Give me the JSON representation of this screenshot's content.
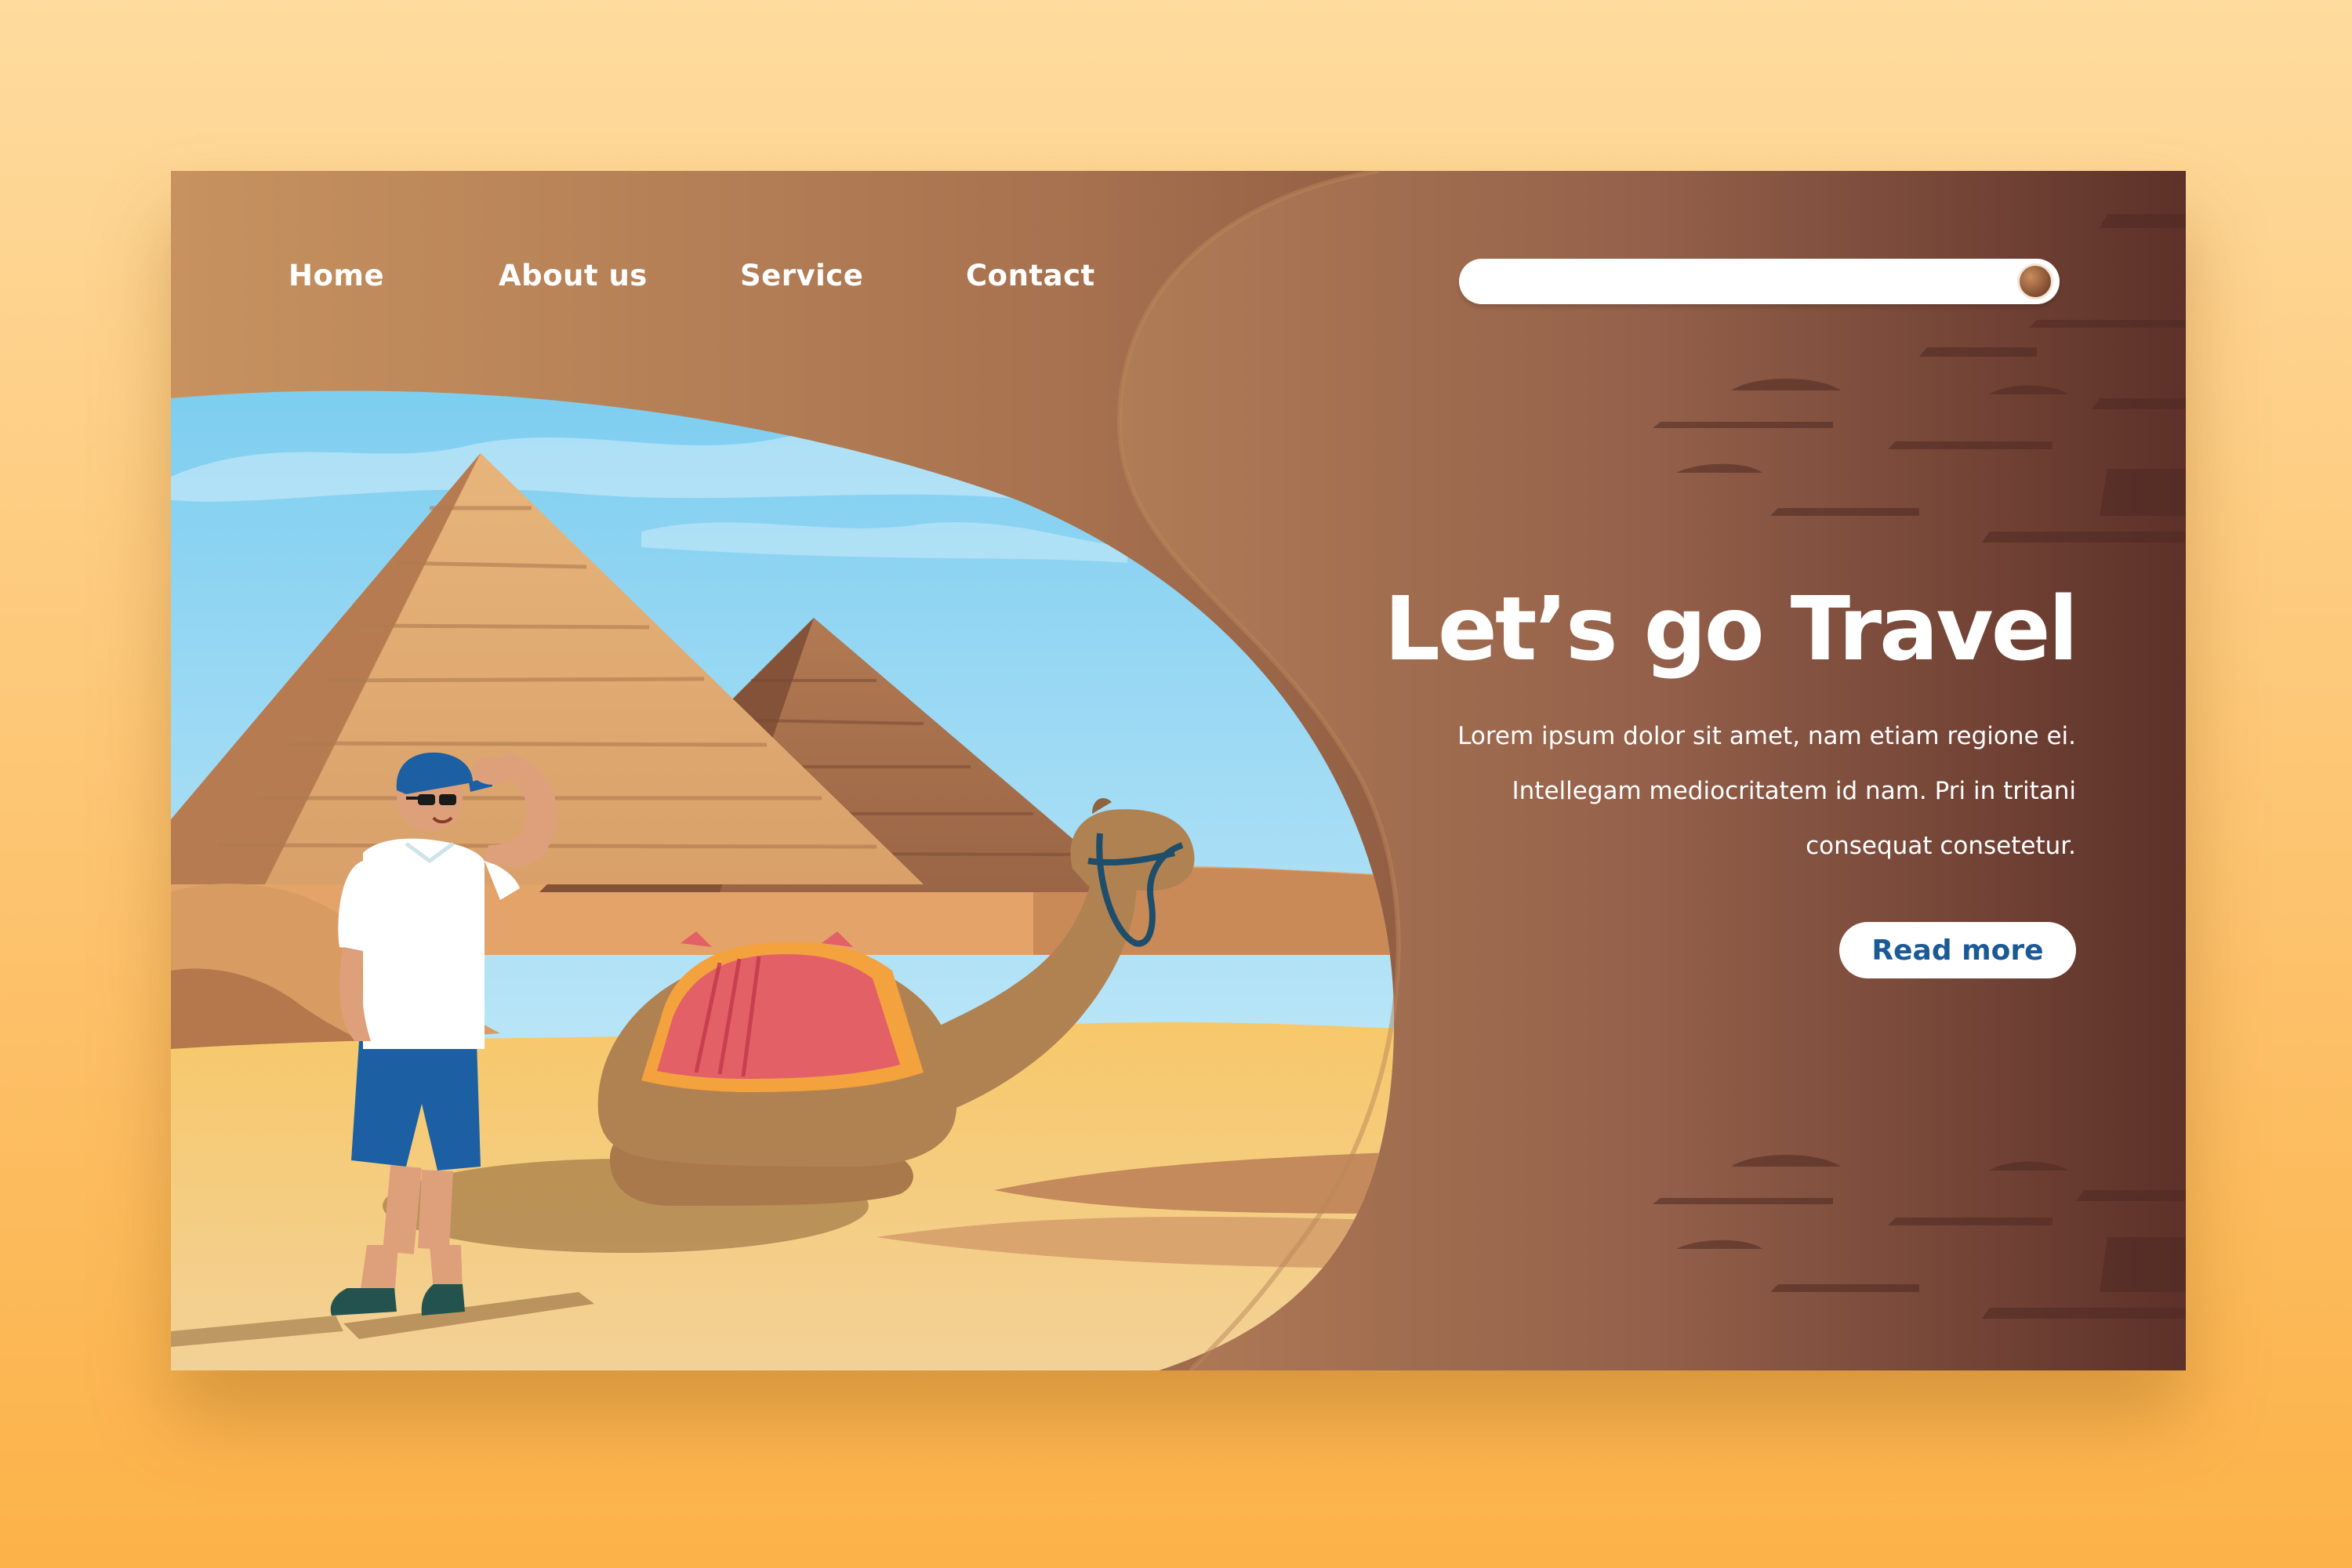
{
  "nav": {
    "items": [
      {
        "label": "Home"
      },
      {
        "label": "About us"
      },
      {
        "label": "Service"
      },
      {
        "label": "Contact"
      }
    ]
  },
  "search": {
    "value": "",
    "icon": "search-knob-icon"
  },
  "hero": {
    "title": "Let’s go Travel",
    "body": "Lorem ipsum dolor sit amet, nam etiam regione ei. Intellegam mediocritatem id nam. Pri in tritani consequat consetetur.",
    "button_label": "Read more"
  },
  "colors": {
    "background_top": "#fedb9e",
    "background_bottom": "#fcb248",
    "panel_light": "#c7905f",
    "panel_dark": "#5e3128",
    "sky": "#8fd6f2",
    "sand": "#f6c56b",
    "button_text": "#1c5a96"
  }
}
